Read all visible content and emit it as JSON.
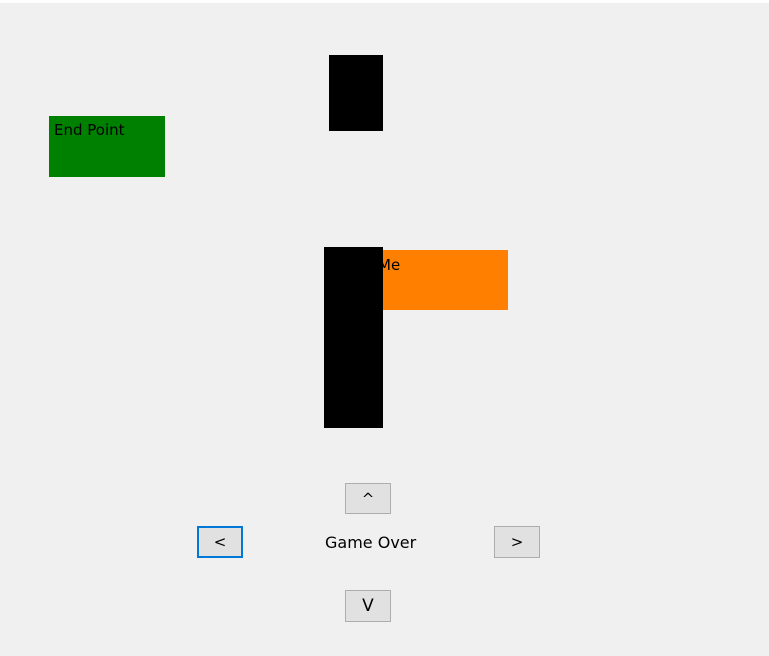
{
  "colors": {
    "window_bg": "#f0f0f0",
    "end_point": "#008000",
    "player": "#ff8000",
    "wall": "#000000",
    "button_bg": "#e1e1e1",
    "button_border": "#adadad",
    "focus_border": "#0078d7"
  },
  "end_point": {
    "label": "End Point"
  },
  "player": {
    "label": "Me"
  },
  "status": {
    "text": "Game Over"
  },
  "controls": {
    "up_label": "^",
    "left_label": "<",
    "right_label": ">",
    "down_label": "V",
    "focused": "left"
  }
}
